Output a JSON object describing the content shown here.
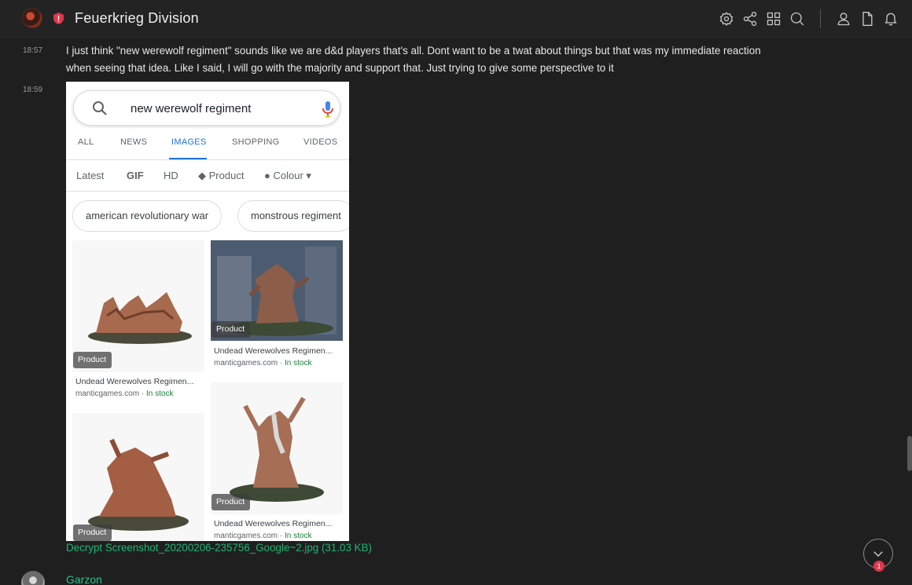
{
  "header": {
    "room_name": "Feuerkrieg Division",
    "icons": [
      "settings-icon",
      "share-icon",
      "widgets-icon",
      "search-icon",
      "person-icon",
      "files-icon",
      "bell-icon"
    ]
  },
  "messages": [
    {
      "time": "18:57",
      "text": "I just think \"new werewolf regiment\" sounds like we are d&d players that's all. Dont want to be a twat about things but that was my immediate reaction when seeing that idea. Like I said, I will go with the majority and support that. Just trying to give some perspective to it"
    },
    {
      "time": "18:59",
      "attachment": {
        "link_text": "Decrypt Screenshot_20200206-235756_Google~2.jpg (31.03 KB)",
        "screenshot": {
          "query": "new werewolf regiment",
          "tabs": [
            "ALL",
            "NEWS",
            "IMAGES",
            "SHOPPING",
            "VIDEOS"
          ],
          "active_tab": "IMAGES",
          "filters": [
            "Latest",
            "GIF",
            "HD",
            "Product",
            "Colour"
          ],
          "chips": [
            "american revolutionary war",
            "monstrous regiment"
          ],
          "results": [
            {
              "badge": "Product",
              "title": "Undead Werewolves Regimen...",
              "source": "manticgames.com",
              "stock": "In stock"
            },
            {
              "badge": "Product",
              "title": "Undead Werewolves Regimen...",
              "source": "manticgames.com",
              "stock": "In stock"
            },
            {
              "badge": "Product",
              "title": "Undead Werewolves Regimen...",
              "source": "manticgames.com",
              "stock": "In stock"
            },
            {
              "badge": "Product",
              "title": "",
              "source": "",
              "stock": ""
            }
          ]
        }
      }
    }
  ],
  "next_sender": "Garzon",
  "jump_badge": "1",
  "colors": {
    "accent": "#1fb573",
    "sender": "#2bc489",
    "badge": "#e0364b"
  }
}
